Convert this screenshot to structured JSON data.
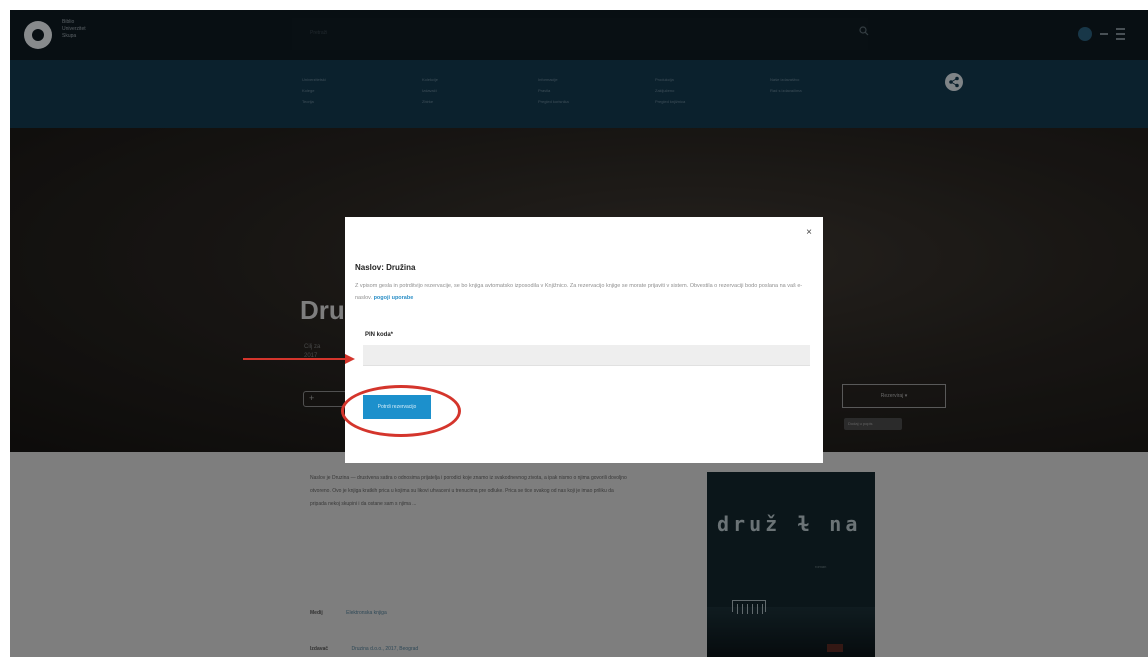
{
  "header": {
    "brand_lines": [
      "Biblio",
      "Univerzitet",
      "Skupa"
    ],
    "search_placeholder": "Pretraži"
  },
  "nav": {
    "columns": [
      [
        "Univerzitetski",
        "Kolege",
        "Teorija"
      ],
      [
        "Kolekcije",
        "Izdavači",
        "Zbirke"
      ],
      [
        "Informacije",
        "Pravila",
        "Pregled korisnika"
      ],
      [
        "Produkcija",
        "Zaključeno",
        "Pregled knjižnica"
      ],
      [
        "Naše izdavaštvo",
        "Rad s izdavačima",
        ""
      ]
    ]
  },
  "hero": {
    "title": "Dru",
    "meta": [
      "Cilj za",
      "2017"
    ],
    "reserve_label": "Rezerviraj ▾",
    "stock_label": "Dodaj u popis"
  },
  "book": {
    "description": "Naslov je Druzina — drustvena satira o odnosima prijatelja i porodici koje znamo iz svakodnevnog zivota, a ipak nismo o njima govorili dovoljno otvoreno. Ovo je knjiga kratkih prica u kojima su likovi uhvaceni u trenucima pre odluke. Prica se tice svakog od nas koji je imao priliku da pripada nekoj skupini i da ostane sam s njima ...",
    "rows": [
      {
        "label": "Medij",
        "value": "Elektronska knjiga"
      },
      {
        "label": "Izdavač",
        "value": "Druzina d.o.o., 2017, Beograd"
      }
    ],
    "cover_title": "druž  ɫ  na",
    "cover_subtitle": "roman"
  },
  "modal": {
    "close": "×",
    "title": "Naslov: Družina",
    "text": "Z vpisom gesla in potrditvijo rezervacije, se bo knjiga avtomatsko izposodila v Knjižnico. Za rezervacijo knjige se morate prijaviti v sistem. Obvestila o rezervaciji bodo poslana na vaš e-naslov.",
    "link_text": "pogoji uporabe",
    "pin_label": "PIN koda*",
    "pin_value": "",
    "submit_label": "Potrdi rezervacijo"
  },
  "annotation": {
    "color": "#d4352c"
  }
}
